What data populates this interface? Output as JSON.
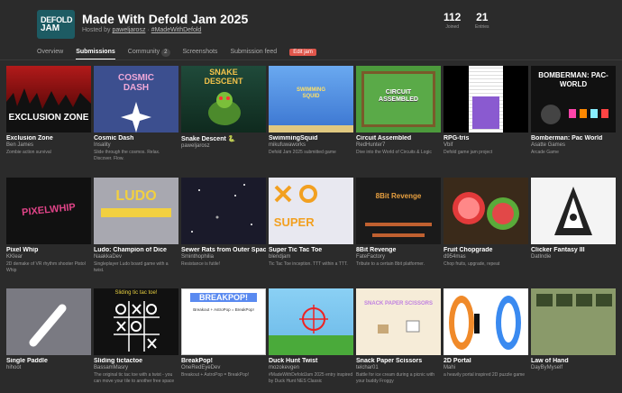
{
  "header": {
    "logo_text_1": "DEFOLD",
    "logo_text_2": "JAM",
    "title": "Made With Defold Jam 2025",
    "hosted_prefix": "Hosted by",
    "host": "paweljarosz",
    "hashtag": "#MadeWithDefold",
    "joined_count": "112",
    "joined_label": "Joined",
    "entries_count": "21",
    "entries_label": "Entries"
  },
  "tabs": {
    "overview": "Overview",
    "submissions": "Submissions",
    "community": "Community",
    "community_count": "2",
    "screenshots": "Screenshots",
    "feed": "Submission feed",
    "edit": "Edit jam"
  },
  "games": [
    {
      "title": "Exclusion Zone",
      "author": "Ben James",
      "desc": "Zombie action survival",
      "thumb_text": "EXCLUSION ZONE"
    },
    {
      "title": "Cosmic Dash",
      "author": "Insality",
      "desc": "Slide through the cosmos. Relax. Discover. Flow.",
      "thumb_text": "COSMIC DASH"
    },
    {
      "title": "Snake Descent 🐍",
      "author": "paweljarosz",
      "desc": "",
      "thumb_text": "SNAKE DESCENT"
    },
    {
      "title": "SwimmingSquid",
      "author": "mikufuwaworks",
      "desc": "Defold Jam 2025 submitted game",
      "thumb_text": "SWIMMING SQUID"
    },
    {
      "title": "Circuit Assembled",
      "author": "RedHunter7",
      "desc": "Dive into the World of Circuits & Logic",
      "thumb_text": "CIRCUIT ASSEMBLED"
    },
    {
      "title": "RPG-tris",
      "author": "Vbif",
      "desc": "Defold game jam project",
      "thumb_text": ""
    },
    {
      "title": "Bomberman: Pac World",
      "author": "Asatte Games",
      "desc": "Arcade Game",
      "thumb_text": "BOMBERMAN: PAC-WORLD"
    },
    {
      "title": "Pixel Whip",
      "author": "KKlear",
      "desc": "2D demake of VR rhythm shooter Pistol Whip",
      "thumb_text": "PIXELWHIP"
    },
    {
      "title": "Ludo: Champion of Dice",
      "author": "NaakkaDev",
      "desc": "Singleplayer Ludo board game with a twist.",
      "thumb_text": "LUDO"
    },
    {
      "title": "Sewer Rats from Outer Space",
      "author": "Sminthophilia",
      "desc": "Resistance is futile!",
      "thumb_text": ""
    },
    {
      "title": "Super Tic Tac Toe",
      "author": "blendjam",
      "desc": "Tic Tac Toe inception. TTT within a TTT.",
      "thumb_text": "SUPER"
    },
    {
      "title": "8Bit Revenge",
      "author": "FateFactory",
      "desc": "Tribute to a certain 8bit platformer.",
      "thumb_text": "8Bit Revenge"
    },
    {
      "title": "Fruit Chopgrade",
      "author": "d954mas",
      "desc": "Chop fruits, upgrade, repeat",
      "thumb_text": ""
    },
    {
      "title": "Clicker Fantasy III",
      "author": "DatIndie",
      "desc": "",
      "thumb_text": ""
    },
    {
      "title": "Single Paddle",
      "author": "hihoot",
      "desc": "",
      "thumb_text": ""
    },
    {
      "title": "Sliding tictactoe",
      "author": "BassamMasry",
      "desc": "The original tic tac toe with a twist - you can move your tile to another free space",
      "thumb_text": "Sliding tic tac toe!"
    },
    {
      "title": "BreakPop!",
      "author": "OneRedEyeDev",
      "desc": "Breakout + AstroPop = BreakPop!",
      "thumb_text": "BREAKPOP!"
    },
    {
      "title": "Duck Hunt Twist",
      "author": "mozokevgen",
      "desc": "#MadeWithDefoldJam 2025 entry inspired by Duck Hunt NES Classic",
      "thumb_text": ""
    },
    {
      "title": "Snack Paper Scissors",
      "author": "telchar01",
      "desc": "Battle for ice cream during a picnic with your buddy Froggy",
      "thumb_text": "SNACK PAPER SCISSORS"
    },
    {
      "title": "2D Portal",
      "author": "Mahi",
      "desc": "a heavily portal inspired 2D puzzle game",
      "thumb_text": ""
    },
    {
      "title": "Law of Hand",
      "author": "DayByMyself",
      "desc": "",
      "thumb_text": ""
    }
  ]
}
